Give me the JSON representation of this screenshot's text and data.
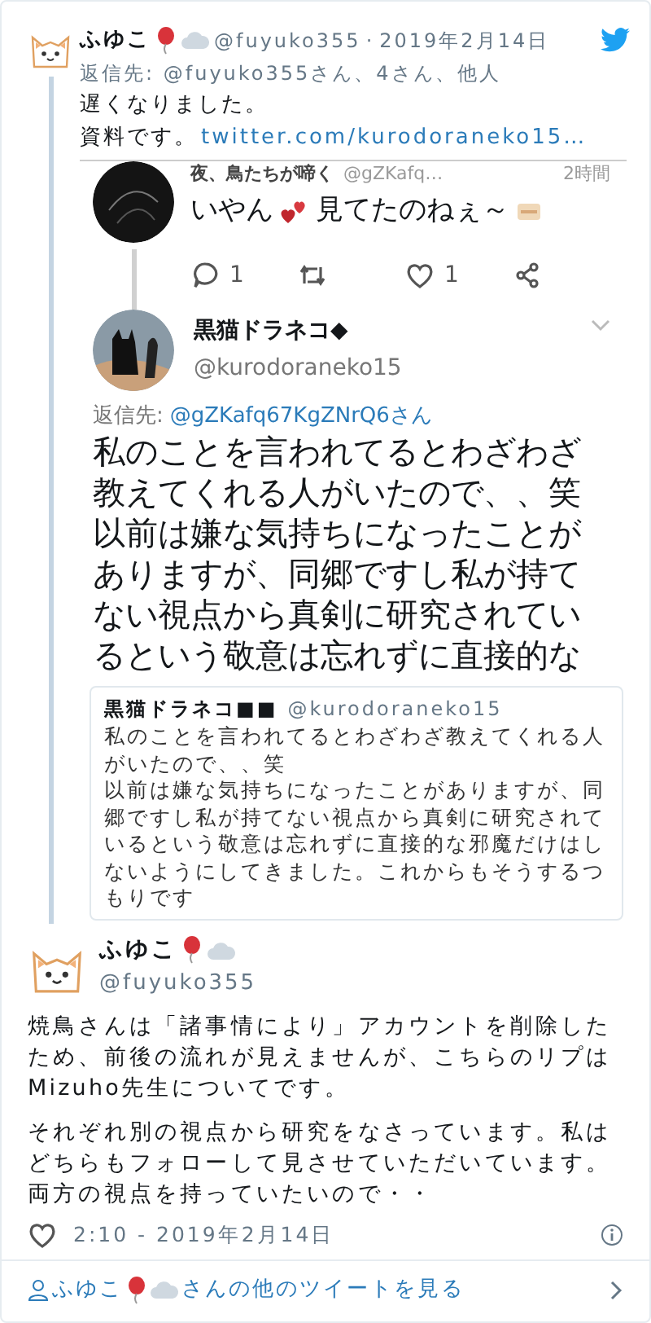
{
  "tweet": {
    "author_name": "ふゆこ",
    "handle": "@fuyuko355",
    "separator": "·",
    "date": "2019年2月14日",
    "reply_to": "返信先: @fuyuko355さん、4さん、他人",
    "text_lines": [
      "遅くなりました。",
      "資料です。"
    ],
    "link": "twitter.com/kurodoraneko15…"
  },
  "screenshot": {
    "previous_tweet": {
      "author_name": "夜、鳥たちが啼く",
      "handle": "@gZKafq…",
      "time": "2時間",
      "text_before": "いやん",
      "text_after": "見てたのねぇ～",
      "actions": [
        {
          "kind": "reply",
          "count": "1"
        },
        {
          "kind": "retweet"
        },
        {
          "kind": "like",
          "count": "1"
        },
        {
          "kind": "share"
        }
      ]
    },
    "reply": {
      "author_name": "黒猫ドラネコ◆",
      "handle": "@kurodoraneko15",
      "reply_to_label": "返信先:",
      "reply_to_handle": "@gZKafq67KgZNrQ6さん",
      "text": "私のことを言われてるとわざわざ教えてくれる人がいたので、、笑以前は嫌な気持ちになったことがありますが、同郷ですし私が持てない視点から真剣に研究されているという敬意は忘れずに直接的な"
    },
    "quoted": {
      "author_name": "黒猫ドラネコ■■",
      "handle": "@kurodoraneko15",
      "paragraphs": [
        "私のことを言われてるとわざわざ教えてくれる人がいたので、、笑",
        "以前は嫌な気持ちになったことがありますが、同郷ですし私が持てない視点から真剣に研究されているという敬意は忘れずに直接的な邪魔だけはしないようにしてきました。これからもそうするつもりです"
      ]
    }
  },
  "main_tweet": {
    "author_name": "ふゆこ",
    "handle": "@fuyuko355",
    "paragraphs": [
      "焼鳥さんは「諸事情により」アカウントを削除したため、前後の流れが見えませんが、こちらのリプはMizuho先生についてです。",
      "それぞれ別の視点から研究をなさっています。私はどちらもフォローして見させていただいています。両方の視点を持っていたいので・・"
    ],
    "timestamp": "2:10 - 2019年2月14日"
  },
  "footer": {
    "name": "ふゆこ",
    "suffix": "さんの他のツイートを見る"
  }
}
